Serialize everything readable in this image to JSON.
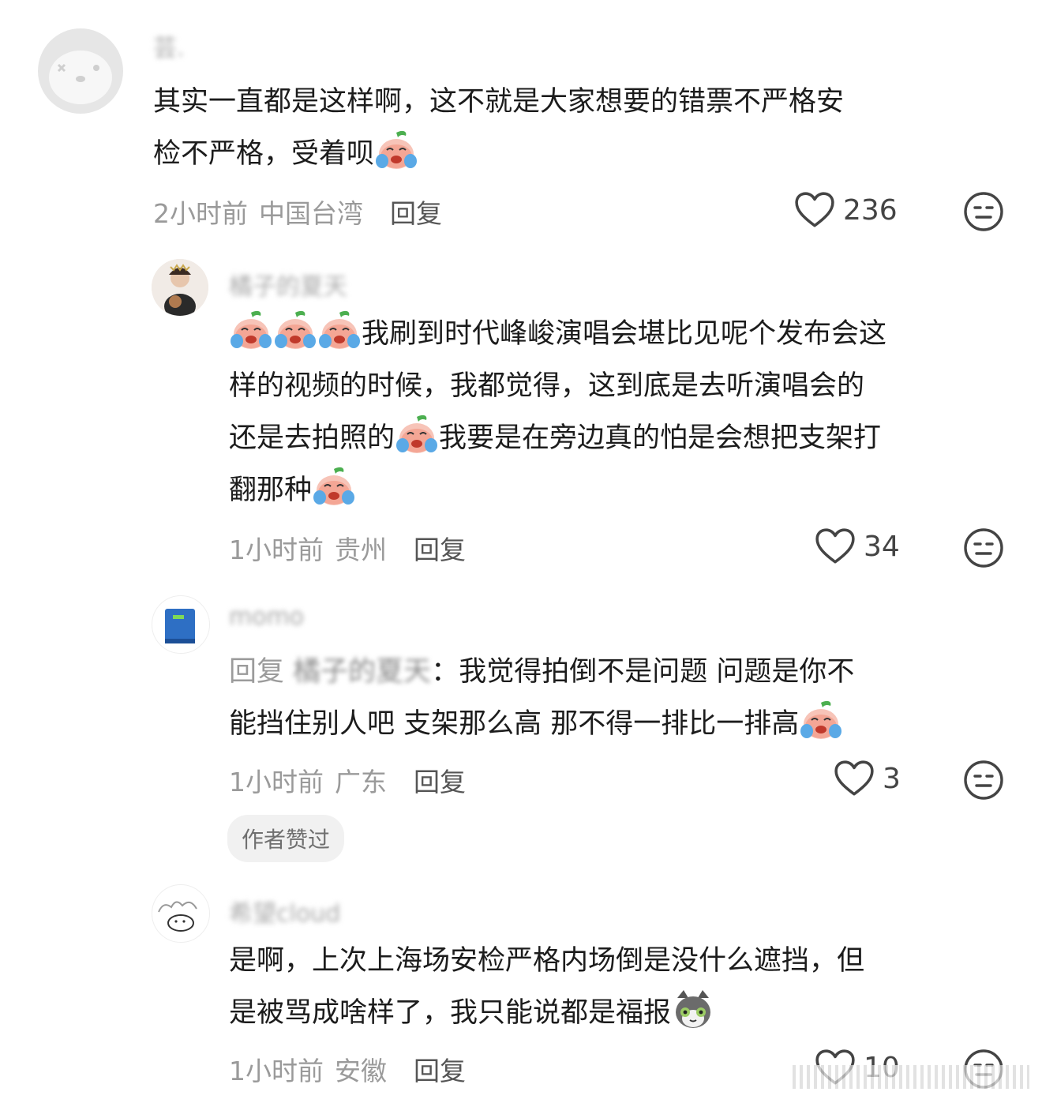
{
  "comments": [
    {
      "username": "芸.",
      "lines": [
        "其实一直都是这样啊，这不就是大家想要的错票不严格安",
        "检不严格，受着呗"
      ],
      "time": "2小时前",
      "location": "中国台湾",
      "reply_label": "回复",
      "likes": "236"
    },
    {
      "username": "橘子的夏天",
      "lines": [
        "我刷到时代峰峻演唱会堪比见呢个发布会这",
        "样的视频的时候，我都觉得，这到底是去听演唱会的",
        "还是去拍照的",
        "我要是在旁边真的怕是会想把支架打",
        "翻那种"
      ],
      "time": "1小时前",
      "location": "贵州",
      "reply_label": "回复",
      "likes": "34"
    },
    {
      "username": "momo",
      "reply_prefix": "回复",
      "reply_target": "橘子的夏天",
      "lines": [
        "我觉得拍倒不是问题 问题是你不",
        "能挡住别人吧 支架那么高 那不得一排比一排高"
      ],
      "time": "1小时前",
      "location": "广东",
      "reply_label": "回复",
      "likes": "3",
      "badge": "作者赞过"
    },
    {
      "username": "希望cloud",
      "lines": [
        "是啊，上次上海场安检严格内场倒是没什么遮挡，但",
        "是被骂成啥样了，我只能说都是福报"
      ],
      "time": "1小时前",
      "location": "安徽",
      "reply_label": "回复",
      "likes": "10"
    }
  ],
  "icons": {
    "like": "heart-outline-icon",
    "dislike": "neutral-face-icon",
    "emoji_cry": "crying-peach-emoji",
    "emoji_cat": "grey-cat-emoji"
  }
}
